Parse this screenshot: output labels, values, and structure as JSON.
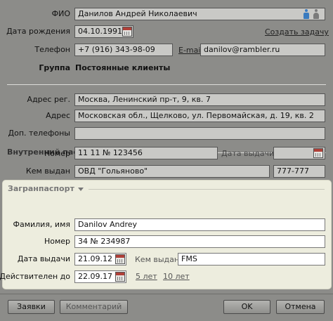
{
  "contact": {
    "fio_label": "ФИО",
    "fio_value": "Данилов Андрей Николаевич",
    "birth_label": "Дата рождения",
    "birth_value": "04.10.1991",
    "create_task_link": "Создать задачу",
    "phone_label": "Телефон",
    "phone_value": "+7 (916) 343-98-09",
    "email_link": "E-mail",
    "email_value": "danilov@rambler.ru",
    "group_label": "Группа",
    "group_value": "Постоянные клиенты"
  },
  "address": {
    "reg_label": "Адрес рег.",
    "reg_value": "Москва, Ленинский пр-т, 9, кв. 7",
    "addr_label": "Адрес",
    "addr_value": "Московская обл., Щелково, ул. Первомайская, д. 19, кв. 2",
    "extra_phones_label": "Доп. телефоны",
    "extra_phones_value": ""
  },
  "internal_passport": {
    "section_title": "Внутренний паспорт",
    "number_label": "Номер",
    "number_value": "11 11 № 123456",
    "issue_date_label": "Дата выдачи",
    "issue_date_value": "",
    "issued_by_label": "Кем выдан",
    "issued_by_value": "ОВД \"Гольяново\"",
    "code_value": "777-777"
  },
  "foreign_passport": {
    "section_title": "Загранпаспорт",
    "name_label": "Фамилия, имя",
    "name_value": "Danilov Andrey",
    "number_label": "Номер",
    "number_value": "34 № 234987",
    "issue_date_label": "Дата выдачи",
    "issue_date_value": "21.09.12",
    "issued_by_label": "Кем выдан",
    "issued_by_value": "FMS",
    "valid_until_label": "Действителен до",
    "valid_until_value": "22.09.17",
    "five_years_link": "5 лет",
    "ten_years_link": "10 лет"
  },
  "buttons": {
    "requests": "Заявки",
    "comment": "Комментарий",
    "ok": "OK",
    "cancel": "Отмена"
  },
  "colors": {
    "window_bg": "#8c8c89",
    "panel_bg": "#ededde",
    "male_icon": "#3a7bbf",
    "female_icon": "#7a7a7a"
  },
  "icons": {
    "gender_male": "male-icon",
    "gender_female": "female-icon",
    "calendar": "calendar-icon",
    "expand": "chevron-down-icon"
  }
}
